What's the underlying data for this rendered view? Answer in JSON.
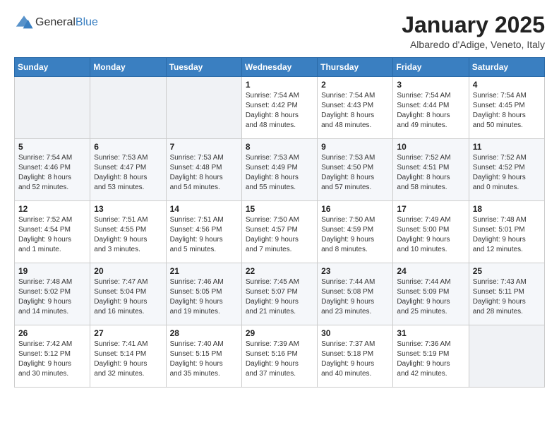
{
  "header": {
    "logo_general": "General",
    "logo_blue": "Blue",
    "month_title": "January 2025",
    "location": "Albaredo d'Adige, Veneto, Italy"
  },
  "days_of_week": [
    "Sunday",
    "Monday",
    "Tuesday",
    "Wednesday",
    "Thursday",
    "Friday",
    "Saturday"
  ],
  "weeks": [
    [
      {
        "day": "",
        "info": ""
      },
      {
        "day": "",
        "info": ""
      },
      {
        "day": "",
        "info": ""
      },
      {
        "day": "1",
        "info": "Sunrise: 7:54 AM\nSunset: 4:42 PM\nDaylight: 8 hours\nand 48 minutes."
      },
      {
        "day": "2",
        "info": "Sunrise: 7:54 AM\nSunset: 4:43 PM\nDaylight: 8 hours\nand 48 minutes."
      },
      {
        "day": "3",
        "info": "Sunrise: 7:54 AM\nSunset: 4:44 PM\nDaylight: 8 hours\nand 49 minutes."
      },
      {
        "day": "4",
        "info": "Sunrise: 7:54 AM\nSunset: 4:45 PM\nDaylight: 8 hours\nand 50 minutes."
      }
    ],
    [
      {
        "day": "5",
        "info": "Sunrise: 7:54 AM\nSunset: 4:46 PM\nDaylight: 8 hours\nand 52 minutes."
      },
      {
        "day": "6",
        "info": "Sunrise: 7:53 AM\nSunset: 4:47 PM\nDaylight: 8 hours\nand 53 minutes."
      },
      {
        "day": "7",
        "info": "Sunrise: 7:53 AM\nSunset: 4:48 PM\nDaylight: 8 hours\nand 54 minutes."
      },
      {
        "day": "8",
        "info": "Sunrise: 7:53 AM\nSunset: 4:49 PM\nDaylight: 8 hours\nand 55 minutes."
      },
      {
        "day": "9",
        "info": "Sunrise: 7:53 AM\nSunset: 4:50 PM\nDaylight: 8 hours\nand 57 minutes."
      },
      {
        "day": "10",
        "info": "Sunrise: 7:52 AM\nSunset: 4:51 PM\nDaylight: 8 hours\nand 58 minutes."
      },
      {
        "day": "11",
        "info": "Sunrise: 7:52 AM\nSunset: 4:52 PM\nDaylight: 9 hours\nand 0 minutes."
      }
    ],
    [
      {
        "day": "12",
        "info": "Sunrise: 7:52 AM\nSunset: 4:54 PM\nDaylight: 9 hours\nand 1 minute."
      },
      {
        "day": "13",
        "info": "Sunrise: 7:51 AM\nSunset: 4:55 PM\nDaylight: 9 hours\nand 3 minutes."
      },
      {
        "day": "14",
        "info": "Sunrise: 7:51 AM\nSunset: 4:56 PM\nDaylight: 9 hours\nand 5 minutes."
      },
      {
        "day": "15",
        "info": "Sunrise: 7:50 AM\nSunset: 4:57 PM\nDaylight: 9 hours\nand 7 minutes."
      },
      {
        "day": "16",
        "info": "Sunrise: 7:50 AM\nSunset: 4:59 PM\nDaylight: 9 hours\nand 8 minutes."
      },
      {
        "day": "17",
        "info": "Sunrise: 7:49 AM\nSunset: 5:00 PM\nDaylight: 9 hours\nand 10 minutes."
      },
      {
        "day": "18",
        "info": "Sunrise: 7:48 AM\nSunset: 5:01 PM\nDaylight: 9 hours\nand 12 minutes."
      }
    ],
    [
      {
        "day": "19",
        "info": "Sunrise: 7:48 AM\nSunset: 5:02 PM\nDaylight: 9 hours\nand 14 minutes."
      },
      {
        "day": "20",
        "info": "Sunrise: 7:47 AM\nSunset: 5:04 PM\nDaylight: 9 hours\nand 16 minutes."
      },
      {
        "day": "21",
        "info": "Sunrise: 7:46 AM\nSunset: 5:05 PM\nDaylight: 9 hours\nand 19 minutes."
      },
      {
        "day": "22",
        "info": "Sunrise: 7:45 AM\nSunset: 5:07 PM\nDaylight: 9 hours\nand 21 minutes."
      },
      {
        "day": "23",
        "info": "Sunrise: 7:44 AM\nSunset: 5:08 PM\nDaylight: 9 hours\nand 23 minutes."
      },
      {
        "day": "24",
        "info": "Sunrise: 7:44 AM\nSunset: 5:09 PM\nDaylight: 9 hours\nand 25 minutes."
      },
      {
        "day": "25",
        "info": "Sunrise: 7:43 AM\nSunset: 5:11 PM\nDaylight: 9 hours\nand 28 minutes."
      }
    ],
    [
      {
        "day": "26",
        "info": "Sunrise: 7:42 AM\nSunset: 5:12 PM\nDaylight: 9 hours\nand 30 minutes."
      },
      {
        "day": "27",
        "info": "Sunrise: 7:41 AM\nSunset: 5:14 PM\nDaylight: 9 hours\nand 32 minutes."
      },
      {
        "day": "28",
        "info": "Sunrise: 7:40 AM\nSunset: 5:15 PM\nDaylight: 9 hours\nand 35 minutes."
      },
      {
        "day": "29",
        "info": "Sunrise: 7:39 AM\nSunset: 5:16 PM\nDaylight: 9 hours\nand 37 minutes."
      },
      {
        "day": "30",
        "info": "Sunrise: 7:37 AM\nSunset: 5:18 PM\nDaylight: 9 hours\nand 40 minutes."
      },
      {
        "day": "31",
        "info": "Sunrise: 7:36 AM\nSunset: 5:19 PM\nDaylight: 9 hours\nand 42 minutes."
      },
      {
        "day": "",
        "info": ""
      }
    ]
  ]
}
